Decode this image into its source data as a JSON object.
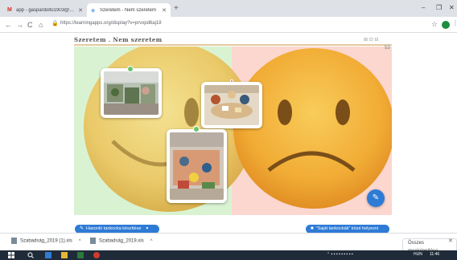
{
  "browser": {
    "tabs": [
      {
        "icon": "gmail-icon",
        "title": "app - gaspardolto1903@gmail.c"
      },
      {
        "icon": "learningapps-icon",
        "title": "Szeretem - Nem szeretem"
      }
    ],
    "new_tab": "+",
    "window_controls": {
      "minimize": "–",
      "maximize": "❐",
      "close": "✕"
    },
    "url": "https://learningapps.org/display?v=prvxpd6aj18",
    "nav": {
      "back": "←",
      "forward": "→",
      "reload": "C",
      "home": "⌂"
    }
  },
  "app": {
    "title": "Szeretem . Nem szeretem",
    "toolbar_icons": "⊞ ⊡ ⊟",
    "counter": "53",
    "colors": {
      "like": "#d9f3d2",
      "dislike": "#fbd7cf",
      "accent": "#2e7bd6"
    }
  },
  "buttons": {
    "create": "Hasonló tankocka készítése",
    "save": "\"Saját tankockák\" közé helyezni"
  },
  "downloads": [
    {
      "name": "Szabadság_2019 (1).xls"
    },
    {
      "name": "Szabadság_2019.xls"
    }
  ],
  "downloads_show_all": "Összes megjelenítése",
  "taskbar": {
    "lang": "HUN",
    "time": "11:46",
    "date": "2019.03.06."
  }
}
